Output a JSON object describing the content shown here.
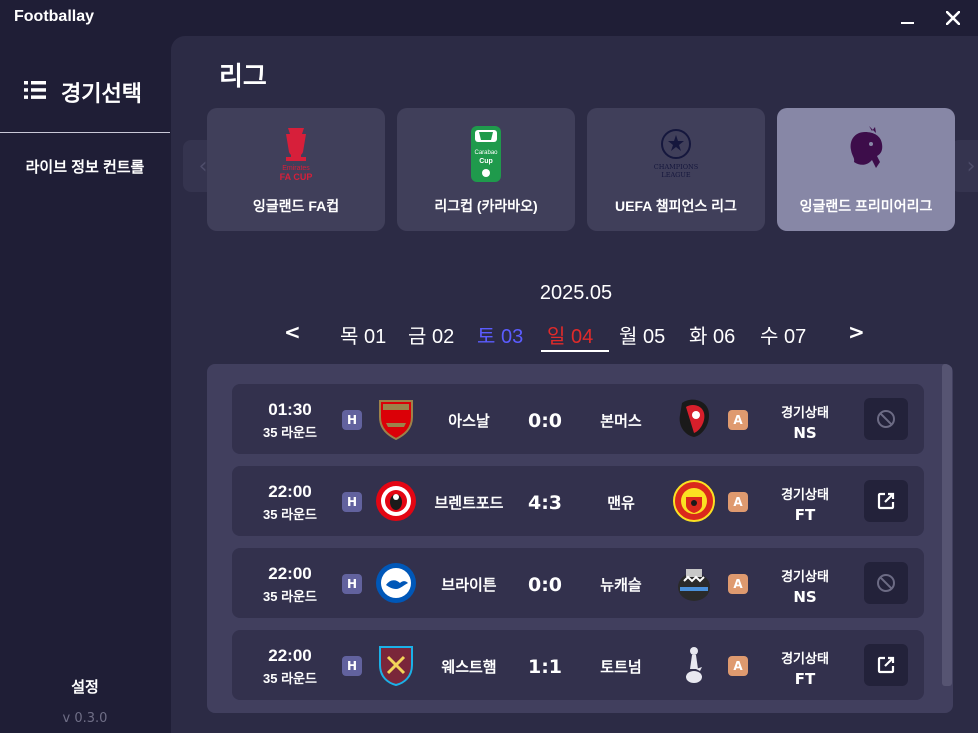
{
  "window": {
    "title": "Footballay"
  },
  "sidebar": {
    "heading": "경기선택",
    "items": [
      {
        "label": "라이브 정보 컨트롤"
      }
    ],
    "settings_label": "설정",
    "version": "v 0.3.0"
  },
  "main": {
    "league_heading": "리그",
    "leagues": [
      {
        "name": "잉글랜드 FA컵",
        "icon": "fa-cup-logo",
        "active": false
      },
      {
        "name": "리그컵 (카라바오)",
        "icon": "carabao-cup-logo",
        "active": false
      },
      {
        "name": "UEFA 챔피언스 리그",
        "icon": "champions-league-logo",
        "active": false
      },
      {
        "name": "잉글랜드 프리미어리그",
        "icon": "premier-league-logo",
        "active": true
      }
    ],
    "month": "2025.05",
    "nav_prev": "<",
    "nav_next": ">",
    "dates": [
      {
        "label": "목 01",
        "kind": "weekday"
      },
      {
        "label": "금 02",
        "kind": "weekday"
      },
      {
        "label": "토 03",
        "kind": "saturday"
      },
      {
        "label": "일 04",
        "kind": "sunday",
        "selected": true
      },
      {
        "label": "월 05",
        "kind": "weekday"
      },
      {
        "label": "화 06",
        "kind": "weekday"
      },
      {
        "label": "수 07",
        "kind": "weekday"
      }
    ],
    "colors": {
      "saturday": "#5b5cff",
      "sunday": "#e02a2a",
      "active_card": "#8787a6",
      "home_badge": "#62629e",
      "away_badge": "#df9a6f"
    }
  },
  "matches": [
    {
      "time": "01:30",
      "round": "35 라운드",
      "home_badge": "H",
      "home": "아스날",
      "home_icon": "arsenal-crest",
      "score": "0:0",
      "away": "본머스",
      "away_icon": "bournemouth-crest",
      "away_badge": "A",
      "status_label": "경기상태",
      "status": "NS",
      "action_icon": "block-icon"
    },
    {
      "time": "22:00",
      "round": "35 라운드",
      "home_badge": "H",
      "home": "브렌트포드",
      "home_icon": "brentford-crest",
      "score": "4:3",
      "away": "맨유",
      "away_icon": "man-utd-crest",
      "away_badge": "A",
      "status_label": "경기상태",
      "status": "FT",
      "action_icon": "external-link-icon"
    },
    {
      "time": "22:00",
      "round": "35 라운드",
      "home_badge": "H",
      "home": "브라이튼",
      "home_icon": "brighton-crest",
      "score": "0:0",
      "away": "뉴캐슬",
      "away_icon": "newcastle-crest",
      "away_badge": "A",
      "status_label": "경기상태",
      "status": "NS",
      "action_icon": "block-icon"
    },
    {
      "time": "22:00",
      "round": "35 라운드",
      "home_badge": "H",
      "home": "웨스트햄",
      "home_icon": "west-ham-crest",
      "score": "1:1",
      "away": "토트넘",
      "away_icon": "tottenham-crest",
      "away_badge": "A",
      "status_label": "경기상태",
      "status": "FT",
      "action_icon": "external-link-icon"
    }
  ]
}
